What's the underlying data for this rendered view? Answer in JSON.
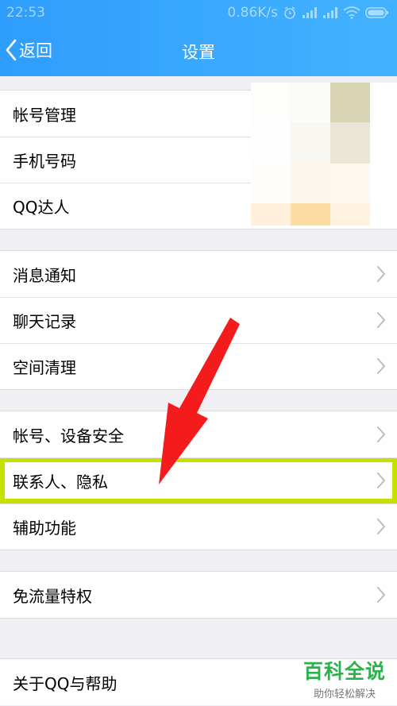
{
  "status_bar": {
    "time": "22:53",
    "speed": "0.86K/s",
    "icons": [
      "alarm-icon",
      "signal-icon",
      "signal-icon",
      "wifi-icon",
      "battery-icon"
    ]
  },
  "nav": {
    "back_label": "返回",
    "title": "设置"
  },
  "groups": [
    {
      "items": [
        {
          "label": "帐号管理"
        },
        {
          "label": "手机号码"
        },
        {
          "label": "QQ达人"
        }
      ]
    },
    {
      "items": [
        {
          "label": "消息通知"
        },
        {
          "label": "聊天记录"
        },
        {
          "label": "空间清理"
        }
      ]
    },
    {
      "items": [
        {
          "label": "帐号、设备安全"
        },
        {
          "label": "联系人、隐私"
        },
        {
          "label": "辅助功能"
        }
      ]
    },
    {
      "items": [
        {
          "label": "免流量特权"
        }
      ]
    },
    {
      "items": [
        {
          "label": "关于QQ与帮助"
        }
      ]
    }
  ],
  "watermark": {
    "title": "百科全说",
    "subtitle": "助你轻松解决"
  },
  "colors": {
    "header": "#2f9dfc",
    "highlight": "#c6e100",
    "arrow": "#f31b1b"
  }
}
